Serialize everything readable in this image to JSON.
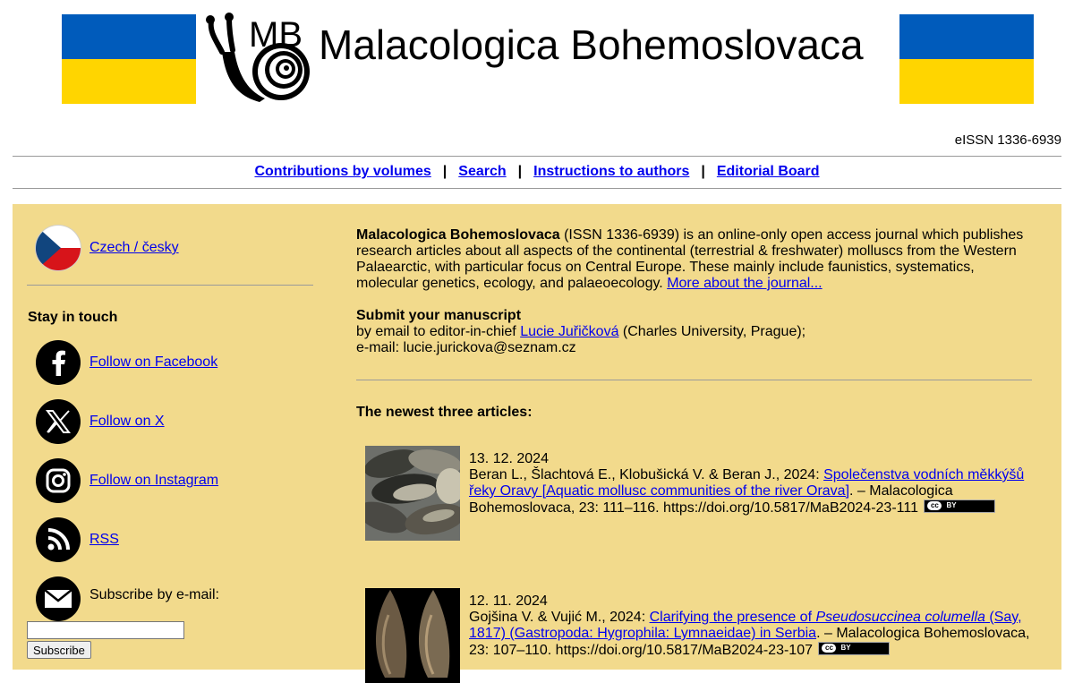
{
  "header": {
    "logo_text": "MB",
    "title": "Malacologica Bohemoslovaca",
    "issn": "eISSN 1336-6939",
    "flag_colors": {
      "blue": "#005bbb",
      "yellow": "#ffd500"
    }
  },
  "nav": {
    "items": [
      {
        "label": "Contributions by volumes"
      },
      {
        "label": "Search"
      },
      {
        "label": "Instructions to authors"
      },
      {
        "label": "Editorial Board"
      }
    ],
    "separator": "|"
  },
  "sidebar": {
    "language_link": "Czech / česky",
    "stay_in_touch": "Stay in touch",
    "social": [
      {
        "label": "Follow on Facebook",
        "icon": "facebook-icon"
      },
      {
        "label": "Follow on X",
        "icon": "x-icon"
      },
      {
        "label": "Follow on Instagram",
        "icon": "instagram-icon"
      },
      {
        "label": "RSS",
        "icon": "rss-icon"
      }
    ],
    "subscribe_label": "Subscribe by e-mail:",
    "subscribe_input_value": "",
    "subscribe_button": "Subscribe",
    "panel_color": "#f2da8c"
  },
  "intro": {
    "journal_name": "Malacologica Bohemoslovaca",
    "description": " (ISSN 1336-6939) is an online-only open access journal which publishes research articles about all aspects of the continental (terrestrial & freshwater) molluscs from the Western Palaearctic, with particular focus on Central Europe. These mainly include faunistics, systematics, molecular genetics, ecology, and palaeoecology. ",
    "more_link": "More about the journal...",
    "submit_heading": "Submit your manuscript",
    "submit_line1_pre": "by email to editor-in-chief ",
    "editor_name": "Lucie Juřičková",
    "submit_line1_post": " (Charles University, Prague);",
    "submit_line2": "e-mail: lucie.jurickova@seznam.cz"
  },
  "newest_heading": "The newest three articles:",
  "articles": [
    {
      "date": "13. 12. 2024",
      "authors": "Beran L., Šlachtová E., Klobušická V. & Beran J., 2024: ",
      "title": "Společenstva vodních měkkýšů řeky Oravy [Aquatic mollusc communities of the river Orava]",
      "citation": ". – Malacologica Bohemoslovaca, 23: 111–116. https://doi.org/10.5817/MaB2024-23-111",
      "license_label": "BY"
    },
    {
      "date": "12. 11. 2024",
      "authors": "Gojšina V. & Vujić M., 2024: ",
      "title_pre": "Clarifying the presence of ",
      "title_italic": "Pseudosuccinea columella",
      "title_post": " (Say, 1817) (Gastropoda: Hygrophila: Lymnaeidae) in Serbia",
      "citation": ". – Malacologica Bohemoslovaca, 23: 107–110. https://doi.org/10.5817/MaB2024-23-107",
      "license_label": "BY"
    }
  ]
}
